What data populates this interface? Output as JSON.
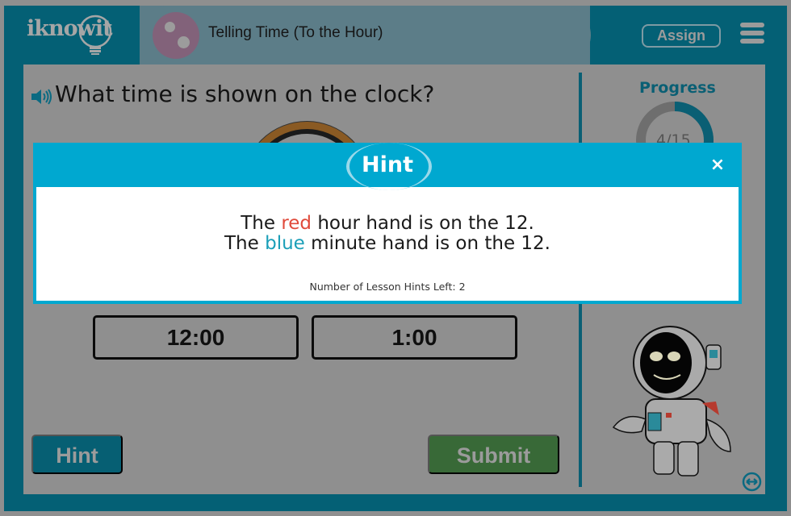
{
  "header": {
    "logo_text": "iknowit",
    "topic_title": "Telling Time (To the Hour)",
    "assign_label": "Assign",
    "menu_icon": "hamburger-menu-icon"
  },
  "question": {
    "speaker_icon": "speaker-icon",
    "text": "What time is shown on the clock?"
  },
  "choices": [
    {
      "label": "12:00"
    },
    {
      "label": "1:00"
    }
  ],
  "buttons": {
    "hint_label": "Hint",
    "submit_label": "Submit"
  },
  "progress": {
    "label": "Progress",
    "current": 4,
    "total": 15,
    "text": "4/15",
    "fraction": 0.267
  },
  "hint_modal": {
    "title": "Hint",
    "close_label": "×",
    "line1": {
      "pre": "The ",
      "color_word": "red",
      "post": " hour hand is on the 12."
    },
    "line2": {
      "pre": "The ",
      "color_word": "blue",
      "post": " minute hand is on the 12."
    },
    "hints_left_text": "Number of Lesson Hints Left: 2"
  },
  "colors": {
    "brand_teal": "#046075",
    "modal_blue": "#00a8d0",
    "hint_red": "#e04a3b",
    "hint_blue": "#1b9fb8",
    "submit_green": "#386937"
  }
}
